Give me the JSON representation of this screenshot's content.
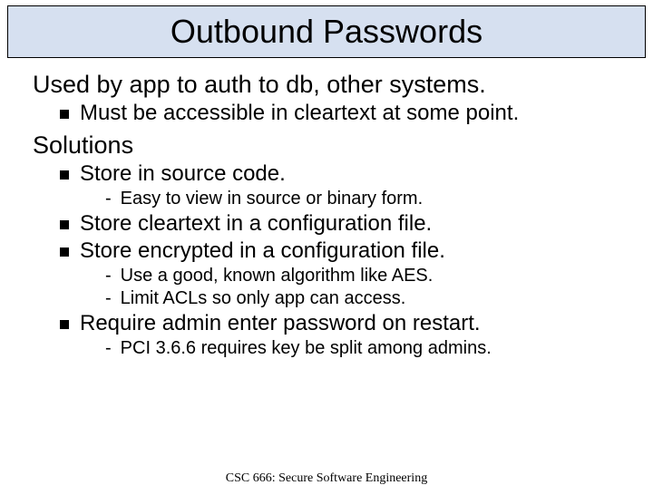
{
  "title": "Outbound Passwords",
  "section1": {
    "heading": "Used by app to auth to db, other systems.",
    "b1": "Must be accessible in cleartext at some point."
  },
  "section2": {
    "heading": "Solutions",
    "b1": "Store in source code.",
    "b1a": "Easy to view in source or binary form.",
    "b2": "Store cleartext in a configuration file.",
    "b3": "Store encrypted in a configuration file.",
    "b3a": "Use a good, known algorithm like AES.",
    "b3b": "Limit ACLs so only app can access.",
    "b4": "Require admin enter password on restart.",
    "b4a": "PCI 3.6.6 requires key be split among admins."
  },
  "footer": "CSC 666: Secure Software Engineering"
}
